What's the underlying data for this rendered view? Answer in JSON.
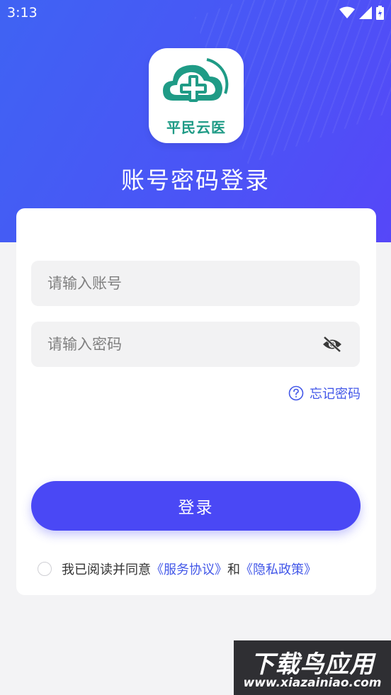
{
  "status_bar": {
    "time": "3:13"
  },
  "app": {
    "logo_text": "平民云医",
    "title": "账号密码登录"
  },
  "form": {
    "account_placeholder": "请输入账号",
    "password_placeholder": "请输入密码",
    "forgot_label": "忘记密码",
    "login_label": "登录"
  },
  "agreement": {
    "prefix": "我已阅读并同意",
    "service_link": "《服务协议》",
    "and": "和",
    "privacy_link": "《隐私政策》",
    "checked": false
  },
  "watermark": {
    "title": "下载鸟应用",
    "url": "www.xiazainiao.com"
  },
  "colors": {
    "header_gradient_start": "#3f63f3",
    "header_gradient_end": "#5647f8",
    "primary": "#4a48f5",
    "link": "#4257e8",
    "logo_green": "#1f9b86"
  },
  "icons": [
    "wifi-icon",
    "signal-icon",
    "battery-icon",
    "eye-off-icon",
    "help-circle-icon",
    "cloud-cross-logo"
  ]
}
